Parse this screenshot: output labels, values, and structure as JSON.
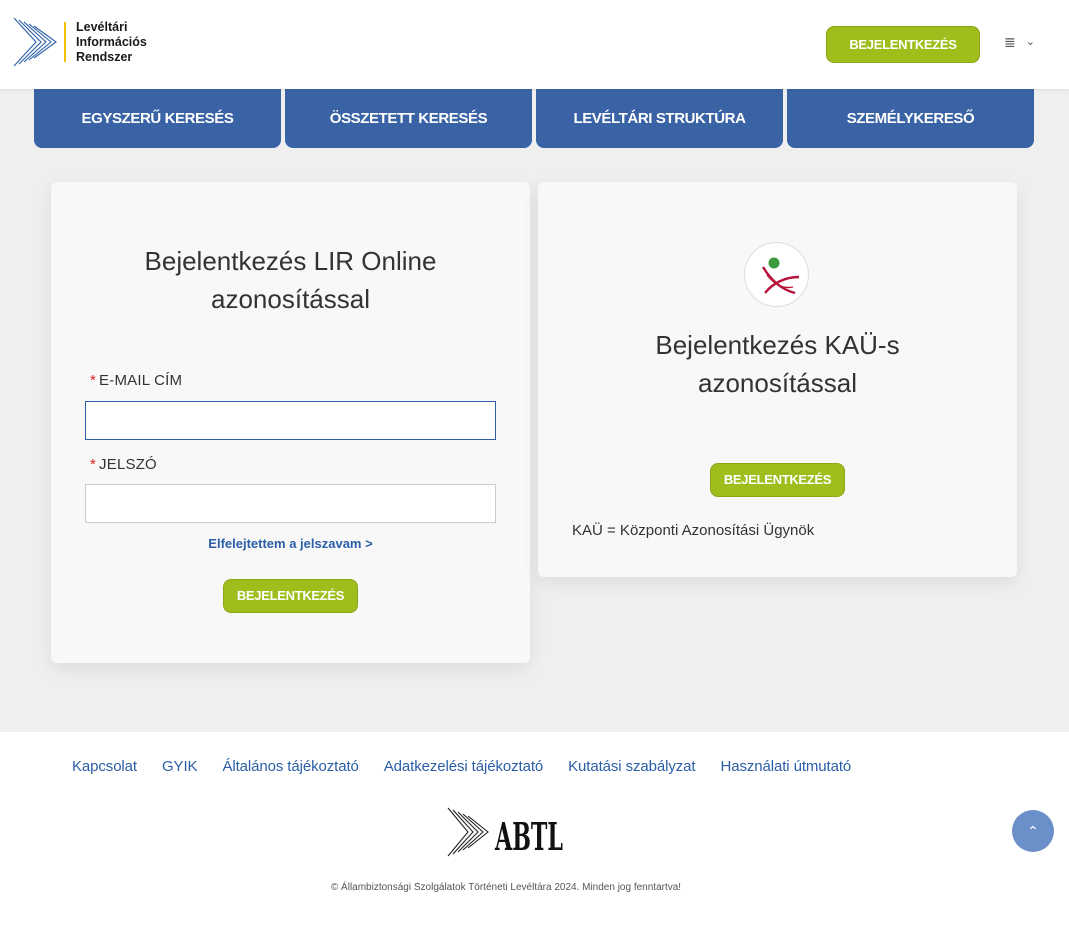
{
  "header": {
    "logo_lines": [
      "Levéltári",
      "Információs",
      "Rendszer"
    ],
    "login_label": "BEJELENTKEZÉS",
    "menu_icon": "≣",
    "chevron_icon": "⌄"
  },
  "nav": {
    "tabs": [
      {
        "label": "EGYSZERŰ KERESÉS"
      },
      {
        "label": "ÖSSZETETT KERESÉS"
      },
      {
        "label": "LEVÉLTÁRI STRUKTÚRA"
      },
      {
        "label": "SZEMÉLYKERESŐ"
      }
    ]
  },
  "login_lir": {
    "title_line1": "Bejelentkezés LIR Online",
    "title_line2": "azonosítással",
    "required_mark": "*",
    "email_label": "E-MAIL CÍM",
    "email_value": "",
    "password_label": "JELSZÓ",
    "password_value": "",
    "forgot_link": "Elfelejtettem a jelszavam >",
    "submit_label": "BEJELENTKEZÉS"
  },
  "login_kau": {
    "title_line1": "Bejelentkezés KAÜ-s",
    "title_line2": "azonosítással",
    "submit_label": "BEJELENTKEZÉS",
    "note": "KAÜ = Központi Azonosítási Ügynök"
  },
  "footer": {
    "links": [
      {
        "label": "Kapcsolat"
      },
      {
        "label": "GYIK"
      },
      {
        "label": "Általános tájékoztató"
      },
      {
        "label": "Adatkezelési tájékoztató"
      },
      {
        "label": "Kutatási szabályzat"
      },
      {
        "label": "Használati útmutató"
      }
    ],
    "logo_text": "ABTL",
    "copyright": "© Állambiztonsági Szolgálatok Történeti Levéltára 2024. Minden jog fenntartva!",
    "scroll_top_icon": "⌃"
  },
  "colors": {
    "nav_blue": "#3a63a6",
    "button_green": "#9fbe1c",
    "link_blue": "#2b5ea7",
    "logo_accent": "#f2c200"
  }
}
